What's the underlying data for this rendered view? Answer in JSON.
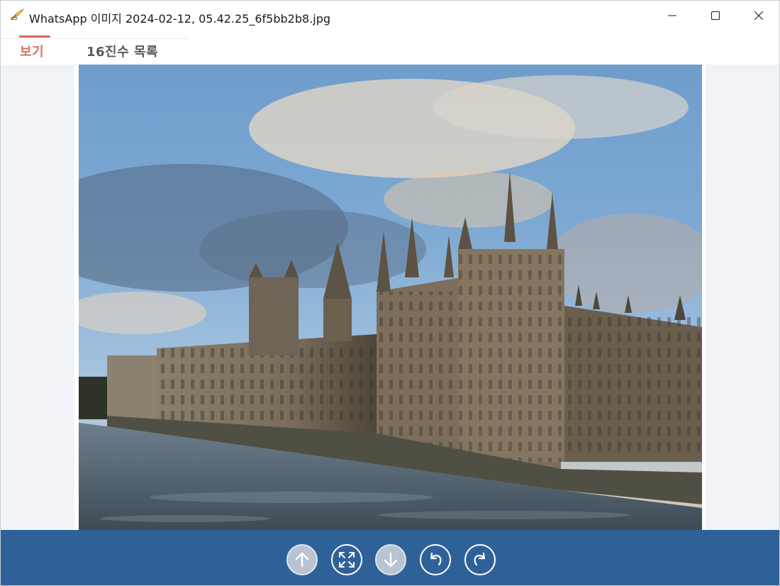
{
  "window": {
    "title": "WhatsApp 이미지 2024-02-12, 05.42.25_6f5bb2b8.jpg",
    "icon": "feather-quill-icon"
  },
  "window_controls": {
    "minimize_icon": "minimize-icon",
    "maximize_icon": "maximize-icon",
    "close_icon": "close-icon"
  },
  "tabs": [
    {
      "label": "보기",
      "active": true
    },
    {
      "label": "16진수 목록",
      "active": false
    }
  ],
  "colors": {
    "accent": "#e0605a",
    "toolbar": "#2f6199",
    "content_bg": "#f1f3f8"
  },
  "image": {
    "subject": "photo-palace-of-westminster"
  },
  "toolbar": {
    "buttons": [
      {
        "icon": "arrow-up-icon",
        "style": "filled"
      },
      {
        "icon": "fit-to-screen-icon",
        "style": "outline"
      },
      {
        "icon": "arrow-down-icon",
        "style": "filled"
      },
      {
        "icon": "rotate-left-icon",
        "style": "outline"
      },
      {
        "icon": "rotate-right-icon",
        "style": "outline"
      }
    ]
  }
}
